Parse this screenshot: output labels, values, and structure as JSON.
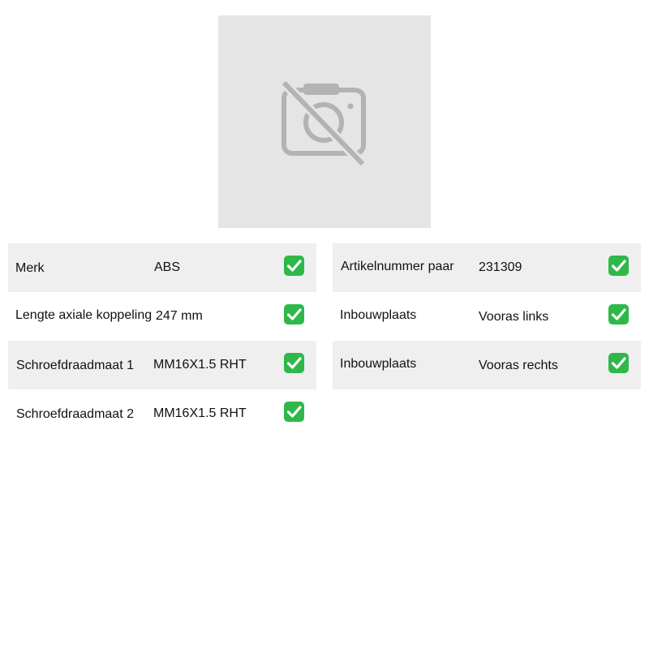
{
  "photo": {
    "icon": "no-photo-icon",
    "placeholder_color": "#e5e5e5"
  },
  "colors": {
    "row_shade": "#efefef",
    "check_green": "#2fb84a"
  },
  "specs_left": [
    {
      "label": "Merk",
      "value": "ABS"
    },
    {
      "label": "Lengte axiale koppeling",
      "value": "247 mm"
    },
    {
      "label": "Schroefdraadmaat 1",
      "value": "MM16X1.5 RHT"
    },
    {
      "label": "Schroefdraadmaat 2",
      "value": "MM16X1.5 RHT"
    }
  ],
  "specs_right": [
    {
      "label": "Artikelnummer paar",
      "value": "231309"
    },
    {
      "label": "Inbouwplaats",
      "value": "Vooras links"
    },
    {
      "label": "Inbouwplaats",
      "value": "Vooras rechts"
    }
  ]
}
